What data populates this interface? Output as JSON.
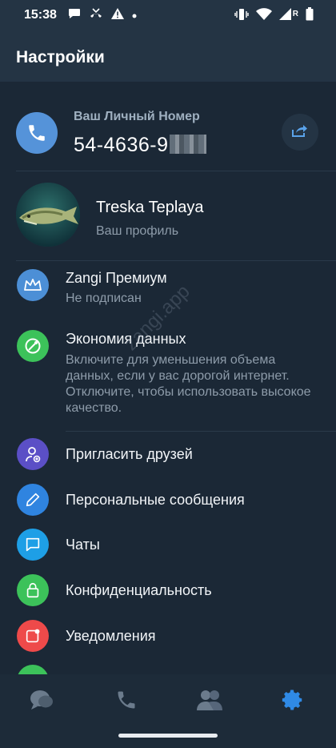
{
  "statusbar": {
    "time": "15:38",
    "roaming": "R"
  },
  "header": {
    "title": "Настройки"
  },
  "personal_number": {
    "label": "Ваш Личный Номер",
    "value": "54-4636-9"
  },
  "profile": {
    "name": "Treska Teplaya",
    "subtitle": "Ваш профиль"
  },
  "menu": {
    "premium": {
      "title": "Zangi Премиум",
      "subtitle": "Не подписан",
      "color": "#4c8fd6"
    },
    "data_saving": {
      "title": "Экономия данных",
      "description": "Включите для уменьшения объема данных, если у вас дорогой интернет. Отключите, чтобы использовать высокое качество.",
      "color": "#3cc25a"
    },
    "invite": {
      "title": "Пригласить друзей",
      "color": "#5b4fc6"
    },
    "personal_messages": {
      "title": "Персональные сообщения",
      "color": "#2f84e0"
    },
    "chats": {
      "title": "Чаты",
      "color": "#1e9fe6"
    },
    "privacy": {
      "title": "Конфиденциальность",
      "color": "#3cc25a"
    },
    "notifications": {
      "title": "Уведомления",
      "color": "#ee4a4a"
    }
  },
  "watermark": "zangi.app",
  "bottom_nav": [
    "chats-icon",
    "phone-icon",
    "contacts-icon",
    "settings-icon"
  ],
  "accent": "#2f8ae6"
}
